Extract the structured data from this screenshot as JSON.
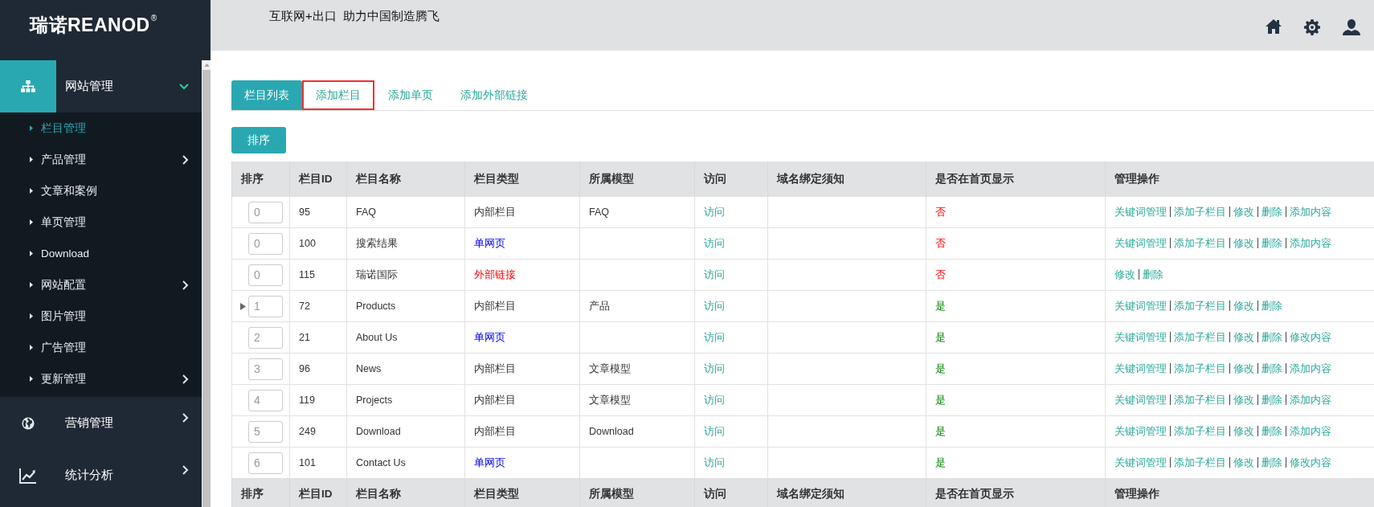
{
  "sidebar": {
    "logo": {
      "text": "瑞诺REANOD",
      "mark": "®"
    },
    "menu": [
      {
        "label": "网站管理",
        "selected": true,
        "expanded": true,
        "children": [
          {
            "label": "栏目管理",
            "selected": true,
            "kind": "link"
          },
          {
            "label": "产品管理",
            "selected": false,
            "kind": "submenu"
          },
          {
            "label": "文章和案例",
            "selected": false,
            "kind": "link"
          },
          {
            "label": "单页管理",
            "selected": false,
            "kind": "link"
          },
          {
            "label": "Download",
            "selected": false,
            "kind": "link"
          },
          {
            "label": "网站配置",
            "selected": false,
            "kind": "submenu"
          },
          {
            "label": "图片管理",
            "selected": false,
            "kind": "link"
          },
          {
            "label": "广告管理",
            "selected": false,
            "kind": "link"
          },
          {
            "label": "更新管理",
            "selected": false,
            "kind": "submenu"
          }
        ]
      },
      {
        "label": "营销管理",
        "selected": false,
        "expanded": false
      },
      {
        "label": "统计分析",
        "selected": false,
        "expanded": false
      }
    ]
  },
  "header": {
    "slogan": "互联网+出口  助力中国制造腾飞"
  },
  "tabs": [
    {
      "label": "栏目列表",
      "selected": true,
      "outlined": false
    },
    {
      "label": "添加栏目",
      "selected": false,
      "outlined": true
    },
    {
      "label": "添加单页",
      "selected": false,
      "outlined": false
    },
    {
      "label": "添加外部链接",
      "selected": false,
      "outlined": false
    }
  ],
  "sort_button": "排序",
  "table": {
    "columns": [
      "排序",
      "栏目ID",
      "栏目名称",
      "栏目类型",
      "所属模型",
      "访问",
      "域名绑定须知",
      "是否在首页显示",
      "管理操作"
    ],
    "rows": [
      {
        "sort": "0",
        "id": "95",
        "name": "FAQ",
        "type": {
          "text": "内部栏目",
          "kind": "internal"
        },
        "model": "FAQ",
        "visit": "访问",
        "home": {
          "text": "否",
          "shown": false
        },
        "actions": [
          "关键词管理",
          "添加子栏目",
          "修改",
          "删除",
          "添加内容"
        ],
        "expandable": false
      },
      {
        "sort": "0",
        "id": "100",
        "name": "搜索结果",
        "type": {
          "text": "单网页",
          "kind": "page"
        },
        "model": "",
        "visit": "访问",
        "home": {
          "text": "否",
          "shown": false
        },
        "actions": [
          "关键词管理",
          "添加子栏目",
          "修改",
          "删除",
          "添加内容"
        ],
        "expandable": false
      },
      {
        "sort": "0",
        "id": "115",
        "name": "瑞诺国际",
        "type": {
          "text": "外部链接",
          "kind": "external"
        },
        "model": "",
        "visit": "访问",
        "home": {
          "text": "否",
          "shown": false
        },
        "actions": [
          "修改",
          "删除"
        ],
        "expandable": false
      },
      {
        "sort": "1",
        "id": "72",
        "name": "Products",
        "type": {
          "text": "内部栏目",
          "kind": "internal"
        },
        "model": "产品",
        "visit": "访问",
        "home": {
          "text": "是",
          "shown": true
        },
        "actions": [
          "关键词管理",
          "添加子栏目",
          "修改",
          "删除"
        ],
        "expandable": true
      },
      {
        "sort": "2",
        "id": "21",
        "name": "About Us",
        "type": {
          "text": "单网页",
          "kind": "page"
        },
        "model": "",
        "visit": "访问",
        "home": {
          "text": "是",
          "shown": true
        },
        "actions": [
          "关键词管理",
          "添加子栏目",
          "修改",
          "删除",
          "修改内容"
        ],
        "expandable": false
      },
      {
        "sort": "3",
        "id": "96",
        "name": "News",
        "type": {
          "text": "内部栏目",
          "kind": "internal"
        },
        "model": "文章模型",
        "visit": "访问",
        "home": {
          "text": "是",
          "shown": true
        },
        "actions": [
          "关键词管理",
          "添加子栏目",
          "修改",
          "删除",
          "添加内容"
        ],
        "expandable": false
      },
      {
        "sort": "4",
        "id": "119",
        "name": "Projects",
        "type": {
          "text": "内部栏目",
          "kind": "internal"
        },
        "model": "文章模型",
        "visit": "访问",
        "home": {
          "text": "是",
          "shown": true
        },
        "actions": [
          "关键词管理",
          "添加子栏目",
          "修改",
          "删除",
          "添加内容"
        ],
        "expandable": false
      },
      {
        "sort": "5",
        "id": "249",
        "name": "Download",
        "type": {
          "text": "内部栏目",
          "kind": "internal"
        },
        "model": "Download",
        "visit": "访问",
        "home": {
          "text": "是",
          "shown": true
        },
        "actions": [
          "关键词管理",
          "添加子栏目",
          "修改",
          "删除",
          "添加内容"
        ],
        "expandable": false
      },
      {
        "sort": "6",
        "id": "101",
        "name": "Contact Us",
        "type": {
          "text": "单网页",
          "kind": "page"
        },
        "model": "",
        "visit": "访问",
        "home": {
          "text": "是",
          "shown": true
        },
        "actions": [
          "关键词管理",
          "添加子栏目",
          "修改",
          "删除",
          "修改内容"
        ],
        "expandable": false
      }
    ],
    "footer": [
      "排序",
      "栏目ID",
      "栏目名称",
      "栏目类型",
      "所属模型",
      "访问",
      "域名绑定须知",
      "是否在首页显示",
      "管理操作"
    ]
  }
}
